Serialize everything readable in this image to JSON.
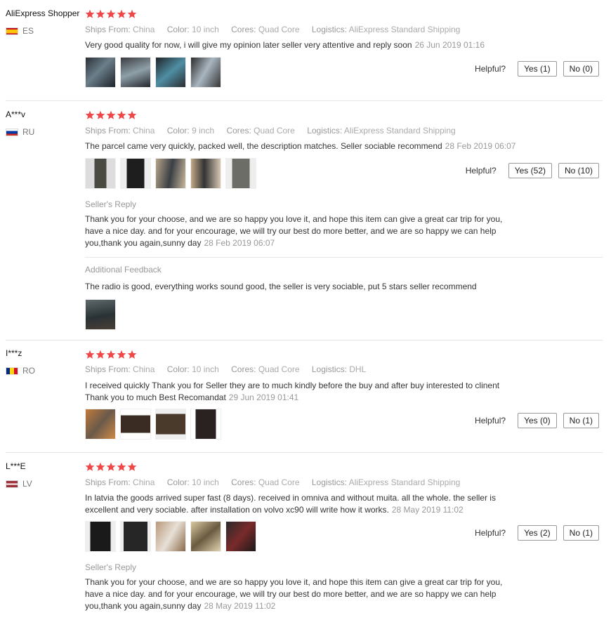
{
  "labels": {
    "ships_from": "Ships From:",
    "color": "Color:",
    "cores": "Cores:",
    "logistics": "Logistics:",
    "helpful": "Helpful?",
    "seller_reply": "Seller's Reply",
    "additional_feedback": "Additional Feedback"
  },
  "colors": {
    "star": "#f04848",
    "text": "#333333",
    "muted": "#999999"
  },
  "reviews": [
    {
      "user": "AliExpress Shopper",
      "country": "ES",
      "rating": 5,
      "ships_from": "China",
      "color": "10 inch",
      "cores": "Quad Core",
      "logistics": "AliExpress Standard Shipping",
      "text": "Very good quality for now, i will give my opinion later seller very attentive and reply soon",
      "date": "26 Jun 2019 01:16",
      "photo_count": 4,
      "yes": "Yes (1)",
      "no": "No (0)"
    },
    {
      "user": "A***v",
      "country": "RU",
      "rating": 5,
      "ships_from": "China",
      "color": "9 inch",
      "cores": "Quad Core",
      "logistics": "AliExpress Standard Shipping",
      "text": "The parcel came very quickly, packed well, the description matches. Seller sociable recommend",
      "date": "28 Feb 2019 06:07",
      "photo_count": 5,
      "yes": "Yes (52)",
      "no": "No (10)",
      "reply_text": "Thank you for your choose, and we are so happy you love it, and hope this item can give a great car trip for you, have a nice day. and for your encourage, we will try our best do more better, and we are so happy we can help you,thank you again,sunny day",
      "reply_date": "28 Feb 2019 06:07",
      "additional_text": "The radio is good, everything works sound good, the seller is very sociable, put 5 stars seller recommend",
      "additional_photo_count": 1
    },
    {
      "user": "I***z",
      "country": "RO",
      "rating": 5,
      "ships_from": "China",
      "color": "10 inch",
      "cores": "Quad Core",
      "logistics": "DHL",
      "text": "I received quickly Thank you for Seller they are to much kindly before the buy and after buy interested to clinent Thank you to much Best Recomandat",
      "date": "29 Jun 2019 01:41",
      "photo_count": 4,
      "yes": "Yes (0)",
      "no": "No (1)"
    },
    {
      "user": "L***E",
      "country": "LV",
      "rating": 5,
      "ships_from": "China",
      "color": "10 inch",
      "cores": "Quad Core",
      "logistics": "AliExpress Standard Shipping",
      "text": "In latvia the goods arrived super fast (8 days). received in omniva and without muita. all the whole. the seller is excellent and very sociable. after installation on volvo xc90 will write how it works.",
      "date": "28 May 2019 11:02",
      "photo_count": 5,
      "yes": "Yes (2)",
      "no": "No (1)",
      "reply_text": "Thank you for your choose, and we are so happy you love it, and hope this item can give a great car trip for you, have a nice day. and for your encourage, we will try our best do more better, and we are so happy we can help you,thank you again,sunny day",
      "reply_date": "28 May 2019 11:02"
    }
  ]
}
